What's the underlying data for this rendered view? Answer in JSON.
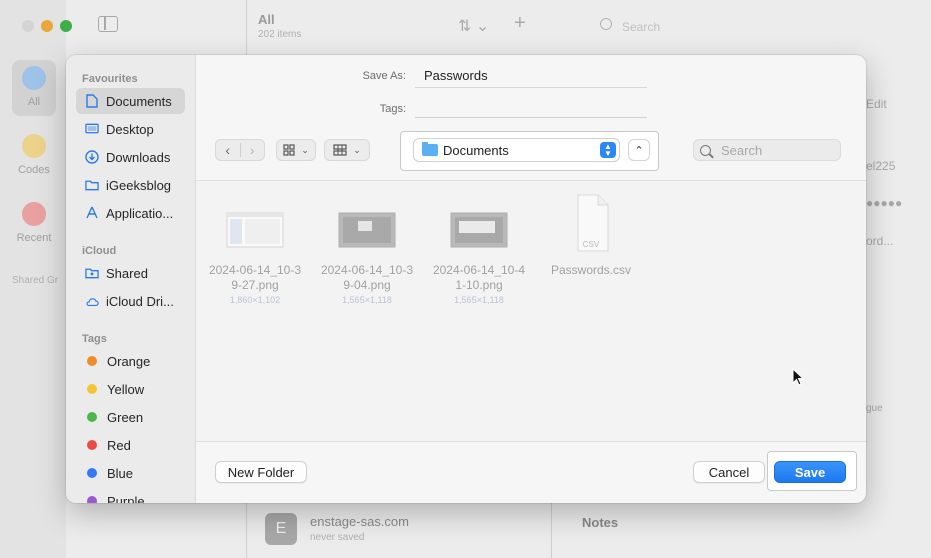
{
  "background": {
    "list": {
      "title": "All",
      "count": "202 items"
    },
    "search_placeholder": "Search",
    "categories": [
      {
        "label": "All",
        "color": "#4a90d9"
      },
      {
        "label": "Codes",
        "color": "#e7b43a"
      },
      {
        "label": "Recent",
        "color": "#d94a4a"
      }
    ],
    "shared_label": "Shared Gr",
    "right_panel": {
      "edit": "Edit",
      "frag1": "el225",
      "dots": "●●●●●",
      "frag2": "ord...",
      "frag3": "gue"
    },
    "entry": {
      "icon_letter": "E",
      "title": "enstage-sas.com",
      "subtitle": "never saved"
    },
    "notes_title": "Notes"
  },
  "dialog": {
    "save_as_label": "Save As:",
    "save_as_value": "Passwords",
    "tags_label": "Tags:",
    "location": "Documents",
    "search_placeholder": "Search",
    "sidebar": {
      "favourites_title": "Favourites",
      "favourites": [
        {
          "label": "Documents",
          "icon": "document-icon"
        },
        {
          "label": "Desktop",
          "icon": "desktop-icon"
        },
        {
          "label": "Downloads",
          "icon": "downloads-icon"
        },
        {
          "label": "iGeeksblog",
          "icon": "folder-icon"
        },
        {
          "label": "Applicatio...",
          "icon": "applications-icon"
        }
      ],
      "icloud_title": "iCloud",
      "icloud": [
        {
          "label": "Shared",
          "icon": "shared-folder-icon"
        },
        {
          "label": "iCloud Dri...",
          "icon": "cloud-icon"
        }
      ],
      "tags_title": "Tags",
      "tags": [
        {
          "label": "Orange",
          "color": "#f08a2a"
        },
        {
          "label": "Yellow",
          "color": "#f2c436"
        },
        {
          "label": "Green",
          "color": "#4fb548"
        },
        {
          "label": "Red",
          "color": "#ec4a45"
        },
        {
          "label": "Blue",
          "color": "#3478f6"
        },
        {
          "label": "Purple",
          "color": "#9b59d0"
        }
      ]
    },
    "files": [
      {
        "name_line1": "2024-06-14_10-3",
        "name_line2": "9-27.png",
        "size": "1,860×1,102",
        "type": "image"
      },
      {
        "name_line1": "2024-06-14_10-3",
        "name_line2": "9-04.png",
        "size": "1,565×1,118",
        "type": "image-dark"
      },
      {
        "name_line1": "2024-06-14_10-4",
        "name_line2": "1-10.png",
        "size": "1,565×1,118",
        "type": "image-dark"
      },
      {
        "name_line1": "Passwords.csv",
        "name_line2": "",
        "size": "",
        "type": "csv",
        "badge": "CSV"
      }
    ],
    "buttons": {
      "new_folder": "New Folder",
      "cancel": "Cancel",
      "save": "Save"
    },
    "accent_color": "#1d79f0"
  }
}
